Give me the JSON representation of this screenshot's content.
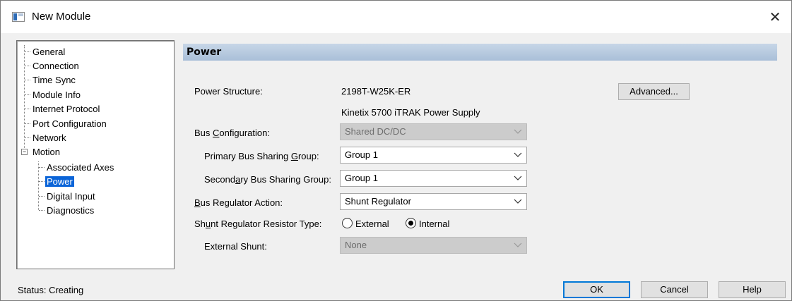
{
  "window": {
    "title": "New Module",
    "close_glyph": "✕"
  },
  "tree": {
    "items": [
      {
        "label": "General"
      },
      {
        "label": "Connection"
      },
      {
        "label": "Time Sync"
      },
      {
        "label": "Module Info"
      },
      {
        "label": "Internet Protocol"
      },
      {
        "label": "Port Configuration"
      },
      {
        "label": "Network"
      },
      {
        "label": "Motion",
        "expanded": true
      },
      {
        "label": "Associated Axes"
      },
      {
        "label": "Power",
        "selected": true
      },
      {
        "label": "Digital Input"
      },
      {
        "label": "Diagnostics"
      }
    ],
    "expander_glyph": "−"
  },
  "section": {
    "title": "Power"
  },
  "form": {
    "power_structure_label": "Power Structure:",
    "power_structure_value": "2198T-W25K-ER",
    "power_structure_desc": "Kinetix 5700 iTRAK Power Supply",
    "advanced_button": "Advanced...",
    "bus_config": {
      "label_pre": "Bus ",
      "label_ul": "C",
      "label_post": "onfiguration:",
      "value": "Shared DC/DC",
      "disabled": true
    },
    "primary_group": {
      "label_pre": "Primary Bus Sharing ",
      "label_ul": "G",
      "label_post": "roup:",
      "value": "Group 1"
    },
    "secondary_group": {
      "label_pre": "Second",
      "label_ul": "a",
      "label_post": "ry Bus Sharing Group:",
      "value": "Group 1"
    },
    "regulator_action": {
      "label_pre": "",
      "label_ul": "B",
      "label_post": "us Regulator Action:",
      "value": "Shunt Regulator"
    },
    "resistor_type": {
      "label_pre": "Sh",
      "label_ul": "u",
      "label_post": "nt Regulator Resistor Type:",
      "options": [
        "External",
        "Internal"
      ],
      "selected": "Internal"
    },
    "external_shunt": {
      "label": "External Shunt:",
      "value": "None",
      "disabled": true
    }
  },
  "status": {
    "text": "Status:  Creating"
  },
  "buttons": {
    "ok": "OK",
    "cancel": "Cancel",
    "help": "Help"
  },
  "colors": {
    "selection": "#0a64d8",
    "header_band": "#b7c9de",
    "default_button_border": "#0078d7"
  }
}
